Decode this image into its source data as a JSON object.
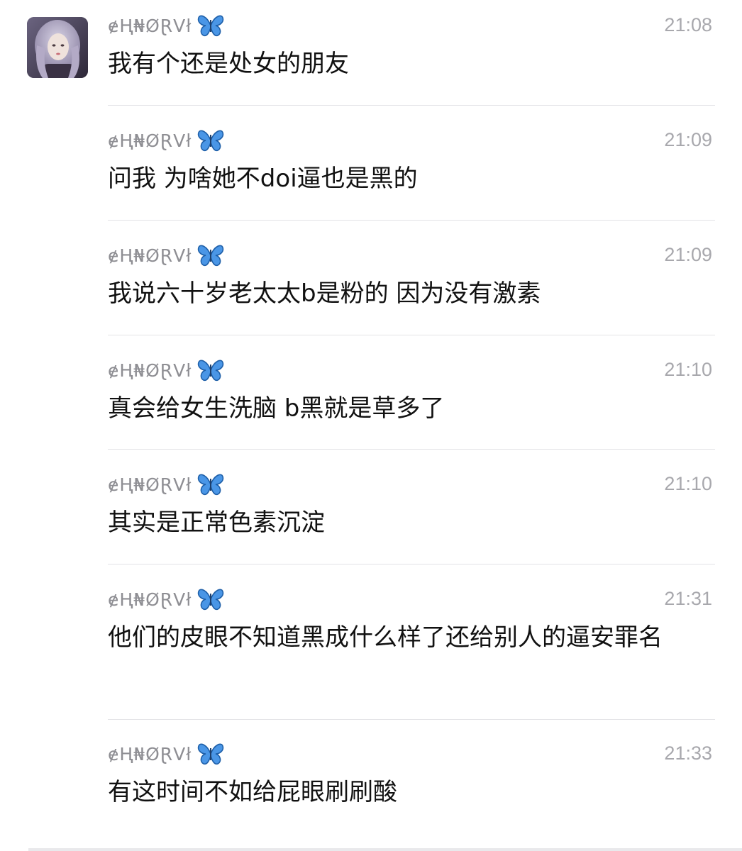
{
  "conversation": {
    "messages": [
      {
        "sender": "ɇⱧ₦ØⱤVł",
        "emoji": "🦋",
        "time": "21:08",
        "text": "我有个还是处女的朋友"
      },
      {
        "sender": "ɇⱧ₦ØⱤVł",
        "emoji": "🦋",
        "time": "21:09",
        "text": "问我 为啥她不doi逼也是黑的"
      },
      {
        "sender": "ɇⱧ₦ØⱤVł",
        "emoji": "🦋",
        "time": "21:09",
        "text": "我说六十岁老太太b是粉的 因为没有激素"
      },
      {
        "sender": "ɇⱧ₦ØⱤVł",
        "emoji": "🦋",
        "time": "21:10",
        "text": "真会给女生洗脑 b黑就是草多了"
      },
      {
        "sender": "ɇⱧ₦ØⱤVł",
        "emoji": "🦋",
        "time": "21:10",
        "text": "其实是正常色素沉淀"
      },
      {
        "sender": "ɇⱧ₦ØⱤVł",
        "emoji": "🦋",
        "time": "21:31",
        "text": "他们的皮眼不知道黑成什么样了还给别人的逼安罪名"
      },
      {
        "sender": "ɇⱧ₦ØⱤVł",
        "emoji": "🦋",
        "time": "21:33",
        "text": "有这时间不如给屁眼刷刷酸"
      }
    ]
  },
  "colors": {
    "sender_gray": "#8e8e93",
    "time_gray": "#a8a8ad",
    "text": "#111111",
    "divider": "#e3e3e6",
    "butterfly_blue": "#3d8de0"
  },
  "icons": {
    "avatar": "user-avatar-photo",
    "emoji": "butterfly-icon"
  }
}
